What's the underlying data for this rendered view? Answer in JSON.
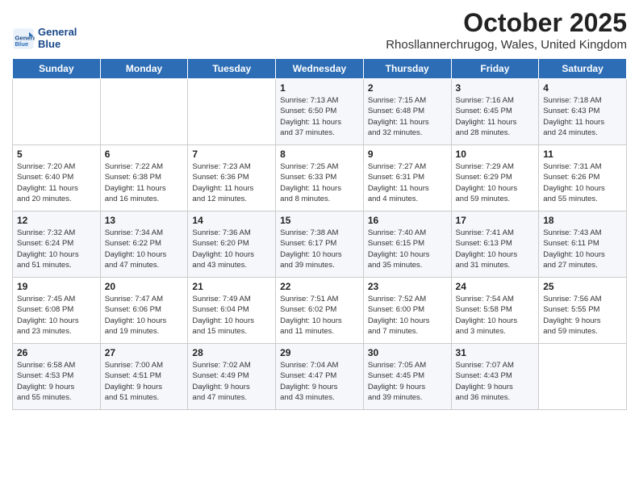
{
  "header": {
    "logo_line1": "General",
    "logo_line2": "Blue",
    "month_title": "October 2025",
    "subtitle": "Rhosllannerchrugog, Wales, United Kingdom"
  },
  "days_of_week": [
    "Sunday",
    "Monday",
    "Tuesday",
    "Wednesday",
    "Thursday",
    "Friday",
    "Saturday"
  ],
  "weeks": [
    [
      {
        "day": "",
        "content": ""
      },
      {
        "day": "",
        "content": ""
      },
      {
        "day": "",
        "content": ""
      },
      {
        "day": "1",
        "content": "Sunrise: 7:13 AM\nSunset: 6:50 PM\nDaylight: 11 hours\nand 37 minutes."
      },
      {
        "day": "2",
        "content": "Sunrise: 7:15 AM\nSunset: 6:48 PM\nDaylight: 11 hours\nand 32 minutes."
      },
      {
        "day": "3",
        "content": "Sunrise: 7:16 AM\nSunset: 6:45 PM\nDaylight: 11 hours\nand 28 minutes."
      },
      {
        "day": "4",
        "content": "Sunrise: 7:18 AM\nSunset: 6:43 PM\nDaylight: 11 hours\nand 24 minutes."
      }
    ],
    [
      {
        "day": "5",
        "content": "Sunrise: 7:20 AM\nSunset: 6:40 PM\nDaylight: 11 hours\nand 20 minutes."
      },
      {
        "day": "6",
        "content": "Sunrise: 7:22 AM\nSunset: 6:38 PM\nDaylight: 11 hours\nand 16 minutes."
      },
      {
        "day": "7",
        "content": "Sunrise: 7:23 AM\nSunset: 6:36 PM\nDaylight: 11 hours\nand 12 minutes."
      },
      {
        "day": "8",
        "content": "Sunrise: 7:25 AM\nSunset: 6:33 PM\nDaylight: 11 hours\nand 8 minutes."
      },
      {
        "day": "9",
        "content": "Sunrise: 7:27 AM\nSunset: 6:31 PM\nDaylight: 11 hours\nand 4 minutes."
      },
      {
        "day": "10",
        "content": "Sunrise: 7:29 AM\nSunset: 6:29 PM\nDaylight: 10 hours\nand 59 minutes."
      },
      {
        "day": "11",
        "content": "Sunrise: 7:31 AM\nSunset: 6:26 PM\nDaylight: 10 hours\nand 55 minutes."
      }
    ],
    [
      {
        "day": "12",
        "content": "Sunrise: 7:32 AM\nSunset: 6:24 PM\nDaylight: 10 hours\nand 51 minutes."
      },
      {
        "day": "13",
        "content": "Sunrise: 7:34 AM\nSunset: 6:22 PM\nDaylight: 10 hours\nand 47 minutes."
      },
      {
        "day": "14",
        "content": "Sunrise: 7:36 AM\nSunset: 6:20 PM\nDaylight: 10 hours\nand 43 minutes."
      },
      {
        "day": "15",
        "content": "Sunrise: 7:38 AM\nSunset: 6:17 PM\nDaylight: 10 hours\nand 39 minutes."
      },
      {
        "day": "16",
        "content": "Sunrise: 7:40 AM\nSunset: 6:15 PM\nDaylight: 10 hours\nand 35 minutes."
      },
      {
        "day": "17",
        "content": "Sunrise: 7:41 AM\nSunset: 6:13 PM\nDaylight: 10 hours\nand 31 minutes."
      },
      {
        "day": "18",
        "content": "Sunrise: 7:43 AM\nSunset: 6:11 PM\nDaylight: 10 hours\nand 27 minutes."
      }
    ],
    [
      {
        "day": "19",
        "content": "Sunrise: 7:45 AM\nSunset: 6:08 PM\nDaylight: 10 hours\nand 23 minutes."
      },
      {
        "day": "20",
        "content": "Sunrise: 7:47 AM\nSunset: 6:06 PM\nDaylight: 10 hours\nand 19 minutes."
      },
      {
        "day": "21",
        "content": "Sunrise: 7:49 AM\nSunset: 6:04 PM\nDaylight: 10 hours\nand 15 minutes."
      },
      {
        "day": "22",
        "content": "Sunrise: 7:51 AM\nSunset: 6:02 PM\nDaylight: 10 hours\nand 11 minutes."
      },
      {
        "day": "23",
        "content": "Sunrise: 7:52 AM\nSunset: 6:00 PM\nDaylight: 10 hours\nand 7 minutes."
      },
      {
        "day": "24",
        "content": "Sunrise: 7:54 AM\nSunset: 5:58 PM\nDaylight: 10 hours\nand 3 minutes."
      },
      {
        "day": "25",
        "content": "Sunrise: 7:56 AM\nSunset: 5:55 PM\nDaylight: 9 hours\nand 59 minutes."
      }
    ],
    [
      {
        "day": "26",
        "content": "Sunrise: 6:58 AM\nSunset: 4:53 PM\nDaylight: 9 hours\nand 55 minutes."
      },
      {
        "day": "27",
        "content": "Sunrise: 7:00 AM\nSunset: 4:51 PM\nDaylight: 9 hours\nand 51 minutes."
      },
      {
        "day": "28",
        "content": "Sunrise: 7:02 AM\nSunset: 4:49 PM\nDaylight: 9 hours\nand 47 minutes."
      },
      {
        "day": "29",
        "content": "Sunrise: 7:04 AM\nSunset: 4:47 PM\nDaylight: 9 hours\nand 43 minutes."
      },
      {
        "day": "30",
        "content": "Sunrise: 7:05 AM\nSunset: 4:45 PM\nDaylight: 9 hours\nand 39 minutes."
      },
      {
        "day": "31",
        "content": "Sunrise: 7:07 AM\nSunset: 4:43 PM\nDaylight: 9 hours\nand 36 minutes."
      },
      {
        "day": "",
        "content": ""
      }
    ]
  ]
}
